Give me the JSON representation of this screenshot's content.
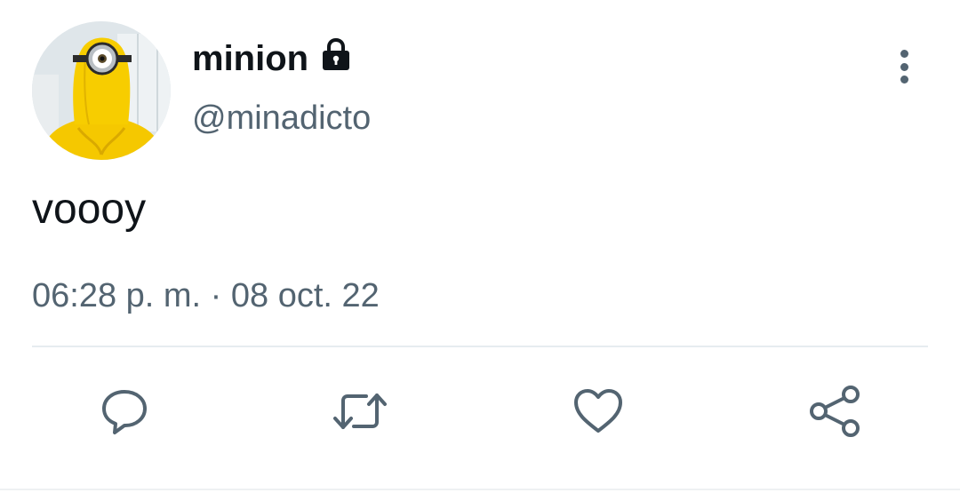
{
  "tweet": {
    "display_name": "minion",
    "handle": "@minadicto",
    "text": "voooy",
    "timestamp": "06:28 p. m. · 08 oct. 22",
    "protected": true
  },
  "icons": {
    "lock": "lock-icon",
    "more": "vertical-ellipsis-icon",
    "reply": "speech-bubble-icon",
    "retweet": "retweet-icon",
    "like": "heart-icon",
    "share": "share-icon"
  },
  "colors": {
    "text_primary": "#0f1419",
    "text_secondary": "#536471",
    "divider": "#e6ecf0",
    "avatar_yellow": "#f5c800"
  }
}
